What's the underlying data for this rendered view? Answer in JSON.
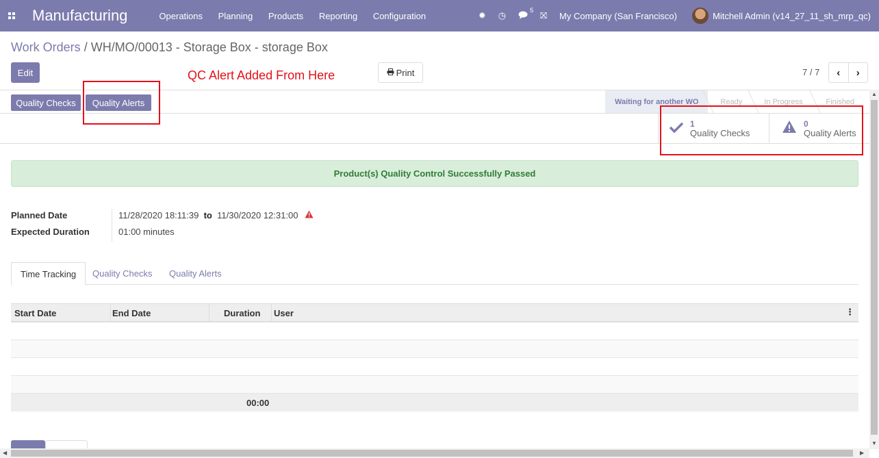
{
  "navbar": {
    "app_name": "Manufacturing",
    "menu": [
      "Operations",
      "Planning",
      "Products",
      "Reporting",
      "Configuration"
    ],
    "systray": {
      "bug": "✹",
      "clock": "◷",
      "chat_count": "5",
      "gift": "⛝",
      "company": "My Company (San Francisco)",
      "user": "Mitchell Admin (v14_27_11_sh_mrp_qc)"
    }
  },
  "control": {
    "breadcrumb_parent": "Work Orders",
    "breadcrumb_sep": " / ",
    "breadcrumb_current": "WH/MO/00013 - Storage Box - storage Box",
    "edit_label": "Edit",
    "print_label": "Print",
    "annotation": "QC Alert Added From Here",
    "pager_value": "7 / 7"
  },
  "header": {
    "btn_quality_checks": "Quality Checks",
    "btn_quality_alerts": "Quality Alerts",
    "stages": [
      "Waiting for another WO",
      "Ready",
      "In Progress",
      "Finished"
    ],
    "active_stage": "Waiting for another WO"
  },
  "smart_buttons": {
    "checks_count": "1",
    "checks_label": "Quality Checks",
    "alerts_count": "0",
    "alerts_label": "Quality Alerts"
  },
  "alert": "Product(s) Quality Control Successfully Passed",
  "fields": {
    "planned_date_label": "Planned Date",
    "planned_start": "11/28/2020 18:11:39",
    "to": "to",
    "planned_end": "11/30/2020 12:31:00",
    "expected_duration_label": "Expected Duration",
    "expected_duration": "01:00 minutes"
  },
  "tabs": [
    "Time Tracking",
    "Quality Checks",
    "Quality Alerts"
  ],
  "active_tab": "Time Tracking",
  "table": {
    "columns": [
      "Start Date",
      "End Date",
      "Duration",
      "User"
    ],
    "rows": [],
    "total_duration": "00:00"
  }
}
